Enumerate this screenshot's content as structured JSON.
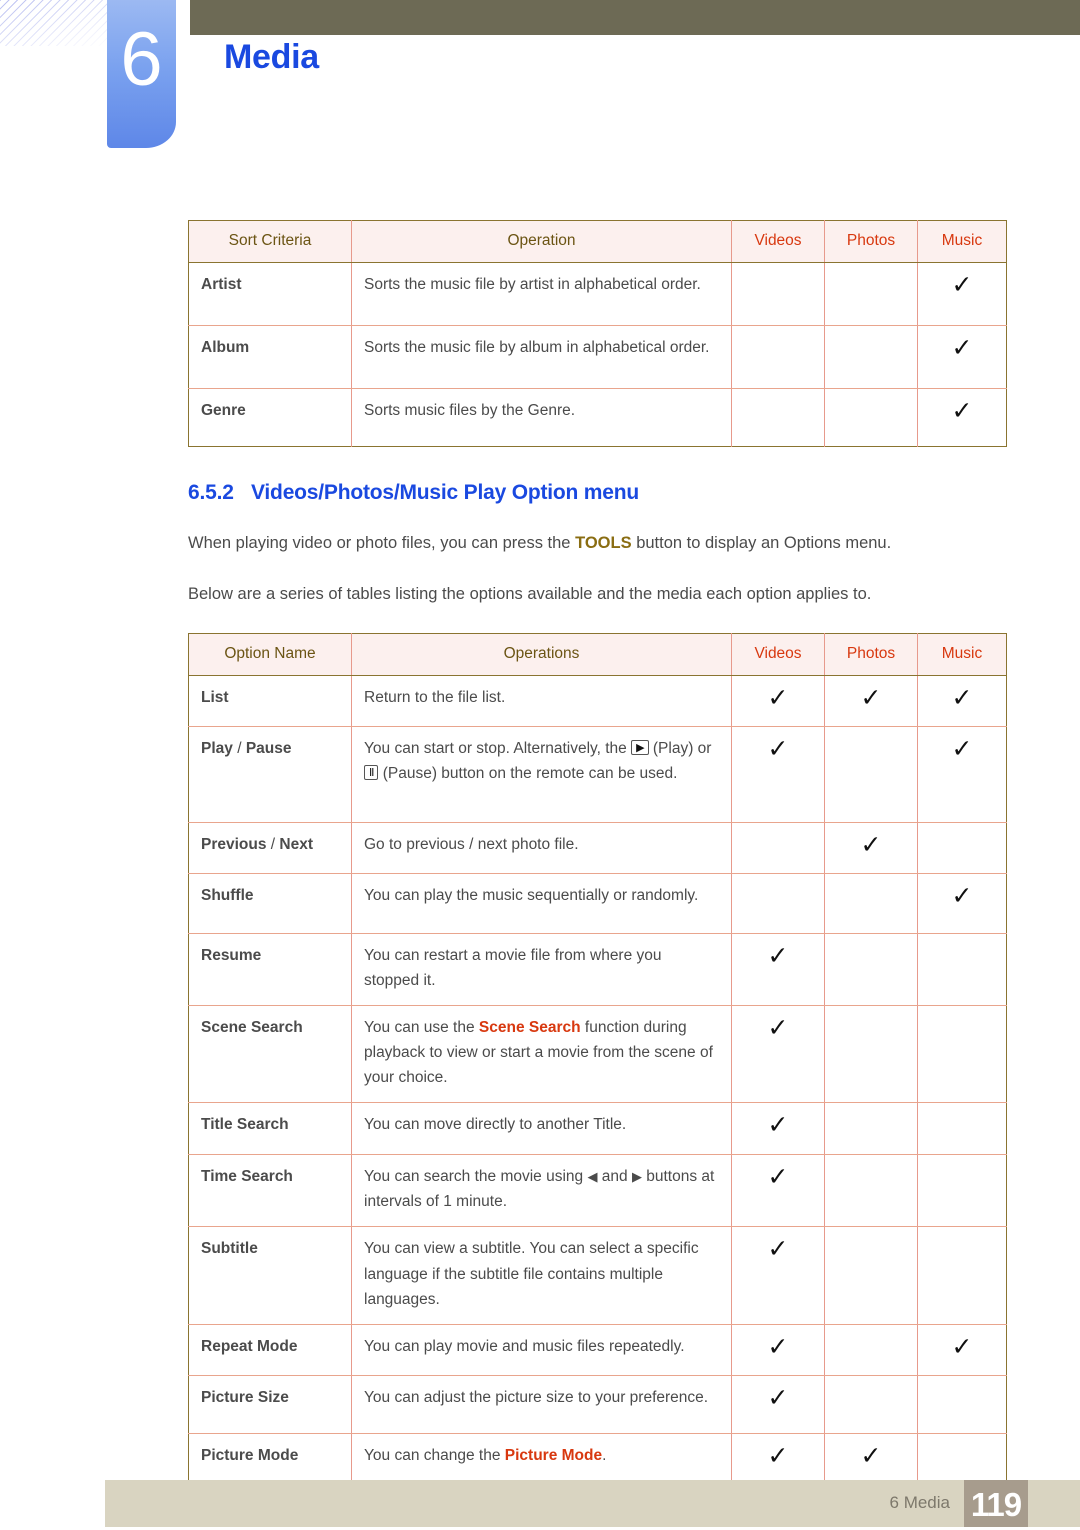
{
  "header": {
    "chapter_number": "6",
    "chapter_title": "Media"
  },
  "sort_table": {
    "columns": [
      "Sort Criteria",
      "Operation",
      "Videos",
      "Photos",
      "Music"
    ],
    "rows": [
      {
        "name": "Artist",
        "operation": "Sorts the music file by artist in alphabetical order.",
        "videos": "",
        "photos": "",
        "music": "✓"
      },
      {
        "name": "Album",
        "operation": "Sorts the music file by album in alphabetical order.",
        "videos": "",
        "photos": "",
        "music": "✓"
      },
      {
        "name": "Genre",
        "operation": "Sorts music files by the Genre.",
        "videos": "",
        "photos": "",
        "music": "✓"
      }
    ]
  },
  "section": {
    "number": "6.5.2",
    "title": "Videos/Photos/Music Play Option menu",
    "paragraph_1_a": "When playing video or photo files, you can press the ",
    "paragraph_1_tools": "TOOLS",
    "paragraph_1_b": " button to display an Options menu.",
    "paragraph_2": "Below are a series of tables listing the options available and the media each option applies to."
  },
  "option_table": {
    "columns": [
      "Option Name",
      "Operations",
      "Videos",
      "Photos",
      "Music"
    ],
    "rows": [
      {
        "name": "List",
        "operation": "Return to the file list.",
        "videos": "✓",
        "photos": "✓",
        "music": "✓"
      },
      {
        "name_a": "Play",
        "sep": " / ",
        "name_b": "Pause",
        "operation_a": "You can start or stop. Alternatively, the ",
        "key_play": "▶",
        "operation_b": " (Play) or ",
        "key_pause": "Ⅱ",
        "operation_c": " (Pause) button on the remote can be used.",
        "videos": "✓",
        "photos": "",
        "music": "✓"
      },
      {
        "name_a": "Previous",
        "sep": " / ",
        "name_b": "Next",
        "operation": "Go to previous / next photo file.",
        "videos": "",
        "photos": "✓",
        "music": ""
      },
      {
        "name": "Shuffle",
        "operation": "You can play the music sequentially or randomly.",
        "videos": "",
        "photos": "",
        "music": "✓"
      },
      {
        "name": "Resume",
        "operation": "You can restart a movie file from where you stopped it.",
        "videos": "✓",
        "photos": "",
        "music": ""
      },
      {
        "name": "Scene Search",
        "operation_a": "You can use the ",
        "operation_hl": "Scene Search",
        "operation_b": " function during playback to view or start a movie from the scene of your choice.",
        "videos": "✓",
        "photos": "",
        "music": ""
      },
      {
        "name": "Title Search",
        "operation": "You can move directly to another Title.",
        "videos": "✓",
        "photos": "",
        "music": ""
      },
      {
        "name": "Time Search",
        "operation_a": "You can search the movie using ",
        "key_left": "◀",
        "operation_b": " and ",
        "key_right": "▶",
        "operation_c": " buttons at intervals of 1 minute.",
        "videos": "✓",
        "photos": "",
        "music": ""
      },
      {
        "name": "Subtitle",
        "operation": "You can view a subtitle. You can select a specific language if the subtitle file contains multiple languages.",
        "videos": "✓",
        "photos": "",
        "music": ""
      },
      {
        "name": "Repeat Mode",
        "operation": "You can play movie and music files repeatedly.",
        "videos": "✓",
        "photos": "",
        "music": "✓"
      },
      {
        "name": "Picture Size",
        "operation": "You can adjust the picture size to your preference.",
        "videos": "✓",
        "photos": "",
        "music": ""
      },
      {
        "name": "Picture Mode",
        "operation_a": "You can change the ",
        "operation_hl": "Picture Mode",
        "operation_b": ".",
        "videos": "✓",
        "photos": "✓",
        "music": ""
      }
    ]
  },
  "footer": {
    "label": "6 Media",
    "page_number": "119"
  },
  "colors": {
    "accent_blue": "#1a49e0",
    "olive_bar": "#6d6a55",
    "table_border": "#8a7430",
    "header_bg": "#fcf0ee",
    "option_red": "#d8380f",
    "footer_bar": "#d9d4c1",
    "page_chip": "#a79c8d"
  }
}
